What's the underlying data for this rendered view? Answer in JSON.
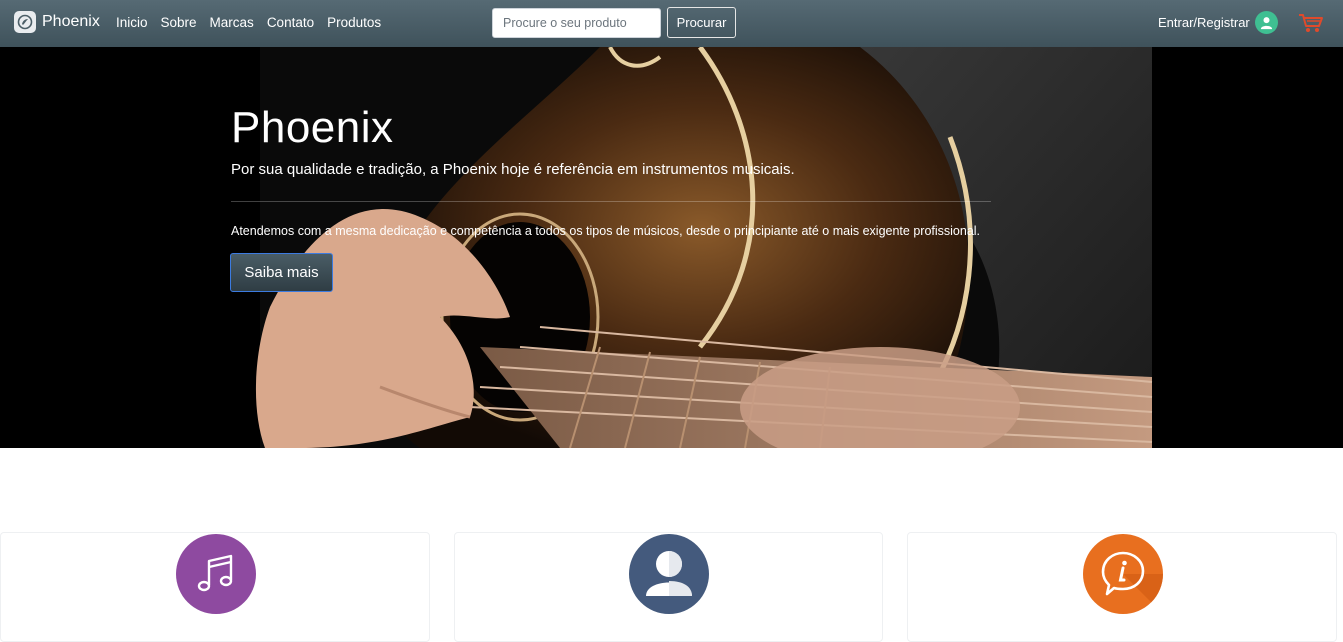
{
  "navbar": {
    "brand": "Phoenix",
    "links": [
      "Inicio",
      "Sobre",
      "Marcas",
      "Contato",
      "Produtos"
    ],
    "search": {
      "placeholder": "Procure o seu produto",
      "value": ""
    },
    "search_button": "Procurar",
    "login_label": "Entrar/Registrar",
    "icons": {
      "brand": "phoenix-logo-icon",
      "user": "user-avatar-icon",
      "cart": "shopping-cart-icon"
    },
    "colors": {
      "bar": "#4b5e67",
      "avatar": "#3fbf92",
      "cart": "#e04a2b"
    }
  },
  "hero": {
    "title": "Phoenix",
    "subtitle": "Por sua qualidade e tradição, a Phoenix hoje é referência em instrumentos musicais.",
    "text": "Atendemos com a mesma dedicação e competência a todos os tipos de músicos, desde o principiante até o mais exigente profissional.",
    "button": "Saiba mais",
    "image": "acoustic-guitar-photo"
  },
  "cards": [
    {
      "icon": "music-note-icon",
      "color": "#8e4aa0"
    },
    {
      "icon": "user-profile-icon",
      "color": "#445a7d"
    },
    {
      "icon": "info-chat-icon",
      "color": "#e86f1f"
    }
  ]
}
